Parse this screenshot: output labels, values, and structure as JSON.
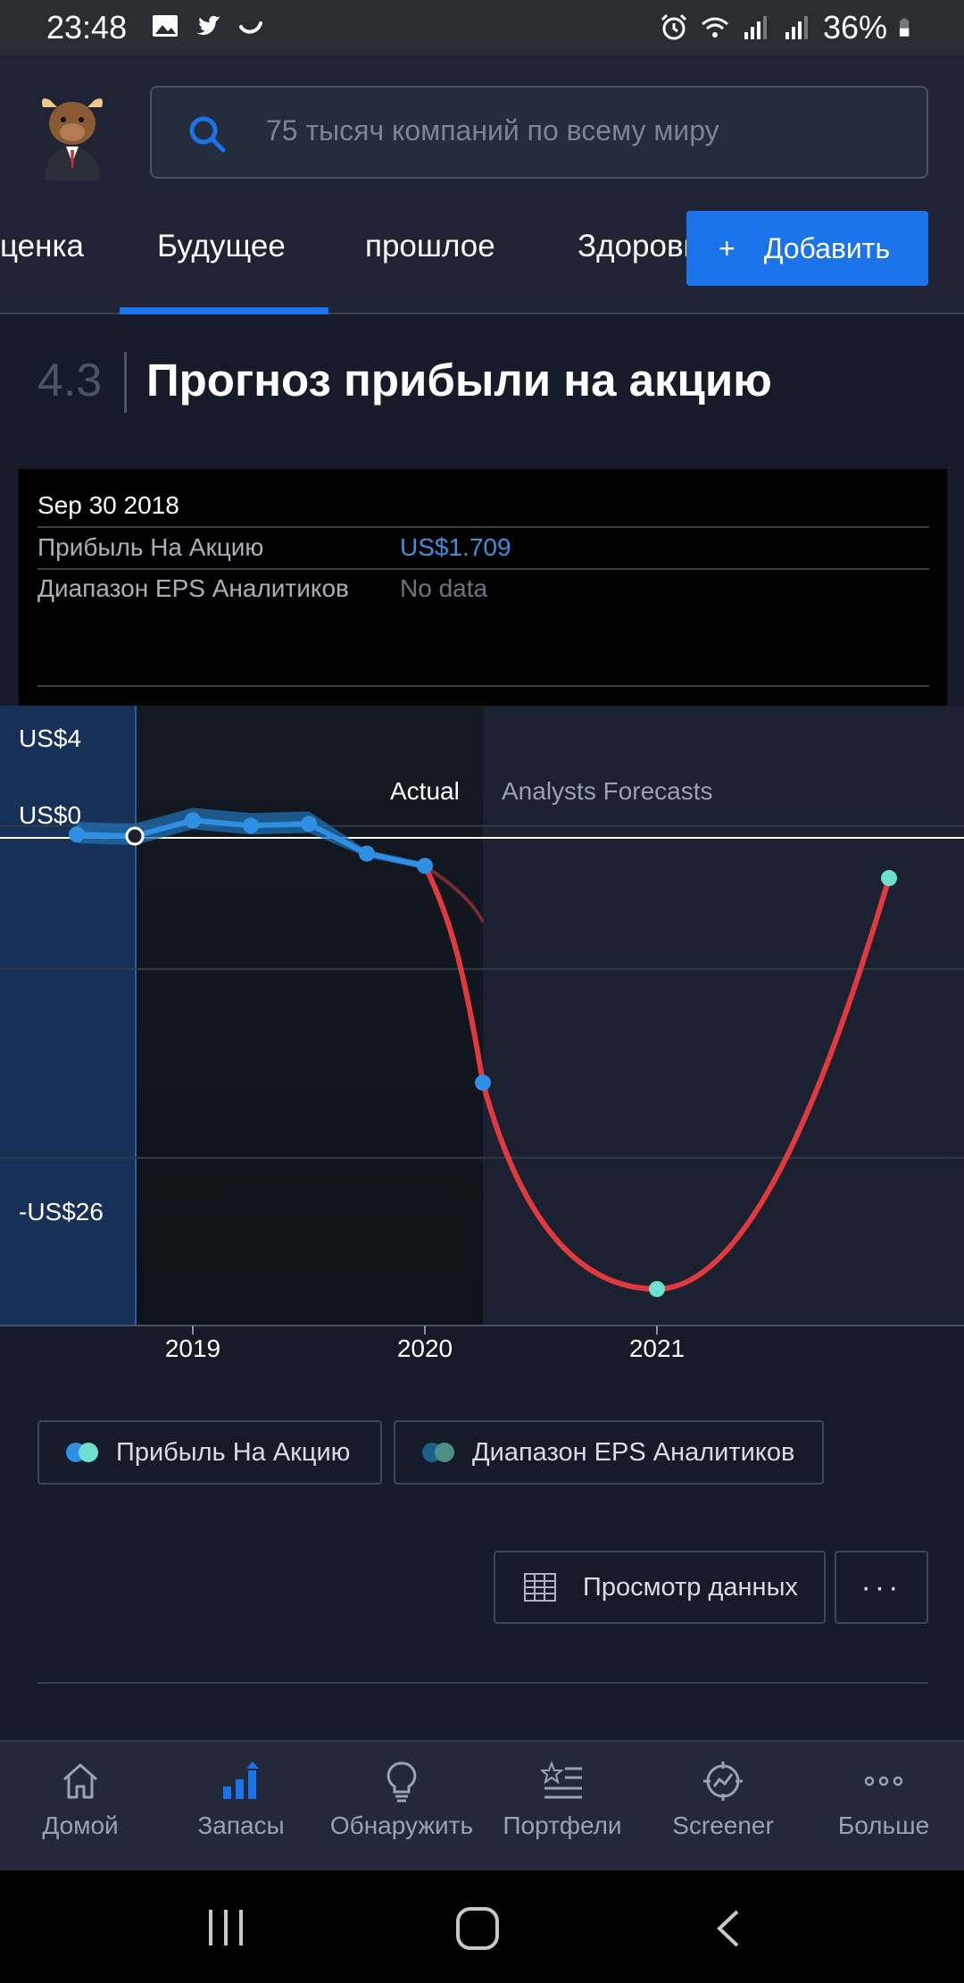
{
  "status_bar": {
    "time": "23:48",
    "battery": "36%",
    "icons_left": [
      "gallery-icon",
      "twitter-icon",
      "moon-icon"
    ],
    "icons_right": [
      "alarm-icon",
      "wifi-icon",
      "signal-icon",
      "signal-icon",
      "battery-icon"
    ]
  },
  "header": {
    "search_placeholder": "75 тысяч компаний по всему миру",
    "tabs": [
      {
        "label": "ценка"
      },
      {
        "label": "Будущее",
        "active": true
      },
      {
        "label": "прошлое"
      },
      {
        "label": "Здоровь"
      }
    ],
    "add_button": "Добавить"
  },
  "section": {
    "number": "4.3",
    "title": "Прогноз прибыли на акцию"
  },
  "tooltip": {
    "date": "Sep 30 2018",
    "rows": [
      {
        "label": "Прибыль На Акцию",
        "value": "US$1.709",
        "value_color": "#3d8fe0"
      },
      {
        "label": "Диапазон EPS Аналитиков",
        "value": "No data",
        "value_color": "#6e7582"
      }
    ]
  },
  "chart_data": {
    "type": "line",
    "y_tick_labels": [
      "US$4",
      "US$0",
      "-US$26"
    ],
    "x_tick_labels": [
      "2019",
      "2020",
      "2021"
    ],
    "region_labels": {
      "actual": "Actual",
      "forecast": "Analysts Forecasts"
    },
    "ylim": [
      -26,
      4
    ],
    "series": [
      {
        "name": "Прибыль На Акцию",
        "color": "#2f8fe3",
        "points": [
          {
            "x": 2018.5,
            "y": 0.2
          },
          {
            "x": 2018.75,
            "y": 0.1
          },
          {
            "x": 2019.0,
            "y": 1.0
          },
          {
            "x": 2019.25,
            "y": 0.7
          },
          {
            "x": 2019.5,
            "y": 0.8
          },
          {
            "x": 2019.75,
            "y": -0.9
          },
          {
            "x": 2020.0,
            "y": -1.6
          },
          {
            "x": 2020.25,
            "y": -14.0
          }
        ]
      },
      {
        "name": "Диапазон EPS Аналитиков",
        "color": "#e03a3e",
        "points": [
          {
            "x": 2020.0,
            "y": -1.6
          },
          {
            "x": 2020.25,
            "y": -14.0
          },
          {
            "x": 2021.0,
            "y": -25.8
          },
          {
            "x": 2022.0,
            "y": -2.3
          }
        ]
      }
    ],
    "grid": true
  },
  "legend": {
    "items": [
      {
        "label": "Прибыль На Акцию",
        "colors": [
          "#2f8fe3",
          "#6fe0cf"
        ]
      },
      {
        "label": "Диапазон EPS Аналитиков",
        "colors": [
          "#1b5f8a",
          "#4d8f87"
        ]
      }
    ]
  },
  "actions": {
    "view_data": "Просмотр данных",
    "more": "···"
  },
  "bottom_nav": {
    "items": [
      {
        "label": "Домой",
        "icon": "home-icon"
      },
      {
        "label": "Запасы",
        "icon": "bar-chart-icon",
        "active": true
      },
      {
        "label": "Обнаружить",
        "icon": "lightbulb-icon"
      },
      {
        "label": "Портфели",
        "icon": "star-list-icon"
      },
      {
        "label": "Screener",
        "icon": "screener-icon"
      },
      {
        "label": "Больше",
        "icon": "more-icon"
      }
    ]
  }
}
